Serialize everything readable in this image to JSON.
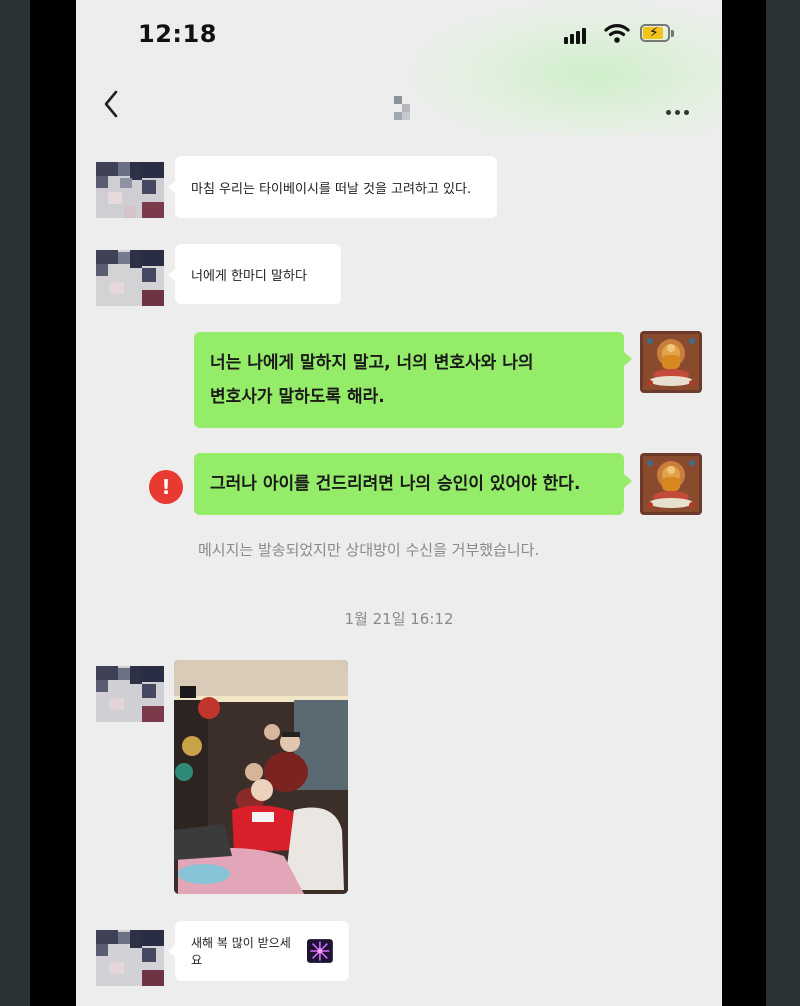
{
  "status_bar": {
    "time": "12:18"
  },
  "nav": {
    "title": ""
  },
  "messages": [
    {
      "text": "마침 우리는 타이베이시를 떠날 것을 고려하고 있다."
    },
    {
      "text": "너에게 한마디 말하다"
    },
    {
      "text_line1": "너는 나에게 말하지 말고, 너의 변호사와 나의",
      "text_line2": "변호사가 말하도록 해라."
    },
    {
      "text": "그러나 아이를 건드리려면 나의 승인이 있어야 한다.",
      "error_icon": "!"
    },
    {
      "text": "새해 복 많이 받으세요"
    }
  ],
  "system_note": "메시지는 발송되었지만 상대방이 수신을 거부했습니다.",
  "timestamp": "1월 21일 16:12",
  "colors": {
    "chat_background": "#ededed",
    "sent_bubble": "#95ec69",
    "received_bubble": "#ffffff",
    "error_red": "#e83a30",
    "meta_text": "#8a8a8a"
  },
  "icons": [
    "back-chevron-icon",
    "more-dots-icon",
    "signal-icon",
    "wifi-icon",
    "battery-charging-icon",
    "error-icon",
    "firework-emoji-icon"
  ]
}
